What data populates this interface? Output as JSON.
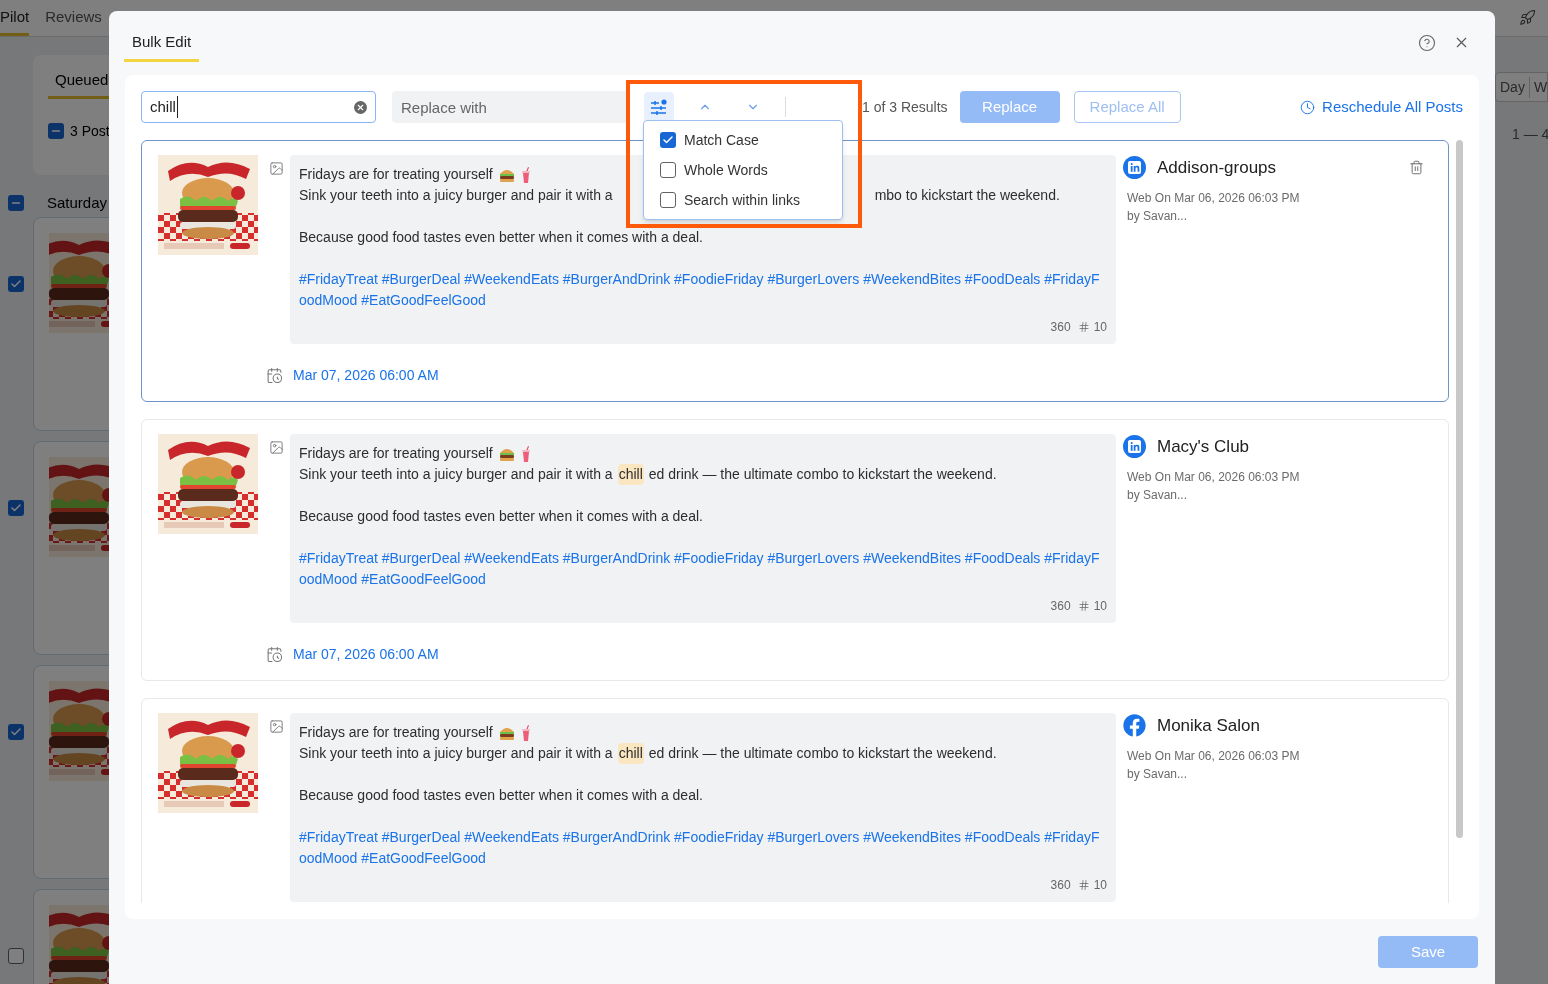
{
  "background": {
    "top_tabs": [
      {
        "label": "Pilot",
        "selected": true
      },
      {
        "label": "Reviews",
        "selected": false
      }
    ],
    "queue_tab": {
      "label": "Queued",
      "selected": true
    },
    "posts_select": {
      "label": "3 Post",
      "indeterminate": true
    },
    "day": {
      "label": "Saturday",
      "indeterminate": true
    },
    "post_checks": [
      {
        "checked": true
      },
      {
        "checked": true
      },
      {
        "checked": true
      },
      {
        "checked": false
      }
    ],
    "view_tabs": [
      "Day",
      "W"
    ],
    "range": "1 — 4"
  },
  "dialog": {
    "tabs": [
      {
        "label": "Bulk Edit",
        "selected": true
      }
    ],
    "search": {
      "value": "chill"
    },
    "replace": {
      "placeholder": "Replace with"
    },
    "result_count": "1 of 3 Results",
    "replace_button": {
      "label": "Replace",
      "disabled": true
    },
    "replace_all_button": {
      "label": "Replace All",
      "disabled": true
    },
    "reschedule_link": "Reschedule All Posts",
    "options": [
      {
        "label": "Match Case",
        "checked": true
      },
      {
        "label": "Whole Words",
        "checked": false
      },
      {
        "label": "Search within links",
        "checked": false
      }
    ],
    "posts": [
      {
        "selected": true,
        "intro": "Fridays are for treating yourself",
        "line": [
          {
            "kind": "text",
            "text": "Sink your teeth into a juicy burger and pair it with a"
          },
          {
            "kind": "covered"
          },
          {
            "kind": "text",
            "text": "mbo to kickstart the weekend."
          }
        ],
        "closing": "Because good food tastes even better when it comes with a deal.",
        "hashtags": "#FridayTreat #BurgerDeal #WeekendEats #BurgerAndDrink #FoodieFriday #BurgerLovers #WeekendBites #FoodDeals #FridayFoodMood #EatGoodFeelGood",
        "char_count": "360",
        "hashtag_count": "10",
        "date": "Mar 07, 2026 06:00 AM",
        "kind": "linkedin",
        "account": "Addison-groups",
        "meta": "Web On Mar 06, 2026 06:03 PM",
        "author": "by Savan...",
        "deletable": true
      },
      {
        "selected": false,
        "intro": "Fridays are for treating yourself",
        "line": [
          {
            "kind": "text",
            "text": "Sink your teeth into a juicy burger and pair it with a"
          },
          {
            "kind": "match",
            "text": "chill"
          },
          {
            "kind": "text",
            "text": "ed drink — the ultimate combo to kickstart the weekend."
          }
        ],
        "closing": "Because good food tastes even better when it comes with a deal.",
        "hashtags": "#FridayTreat #BurgerDeal #WeekendEats #BurgerAndDrink #FoodieFriday #BurgerLovers #WeekendBites #FoodDeals #FridayFoodMood #EatGoodFeelGood",
        "char_count": "360",
        "hashtag_count": "10",
        "date": "Mar 07, 2026 06:00 AM",
        "kind": "linkedin",
        "account": "Macy's Club",
        "meta": "Web On Mar 06, 2026 06:03 PM",
        "author": "by Savan...",
        "deletable": false
      },
      {
        "selected": false,
        "intro": "Fridays are for treating yourself",
        "line": [
          {
            "kind": "text",
            "text": "Sink your teeth into a juicy burger and pair it with a"
          },
          {
            "kind": "match",
            "text": "chill"
          },
          {
            "kind": "text",
            "text": "ed drink — the ultimate combo to kickstart the weekend."
          }
        ],
        "closing": "Because good food tastes even better when it comes with a deal.",
        "hashtags": "#FridayTreat #BurgerDeal #WeekendEats #BurgerAndDrink #FoodieFriday #BurgerLovers #WeekendBites #FoodDeals #FridayFoodMood #EatGoodFeelGood",
        "char_count": "360",
        "hashtag_count": "10",
        "kind": "facebook",
        "account": "Monika Salon",
        "meta": "Web On Mar 06, 2026 06:03 PM",
        "author": "by Savan...",
        "deletable": false
      }
    ],
    "save_button": {
      "label": "Save",
      "disabled": true
    }
  }
}
